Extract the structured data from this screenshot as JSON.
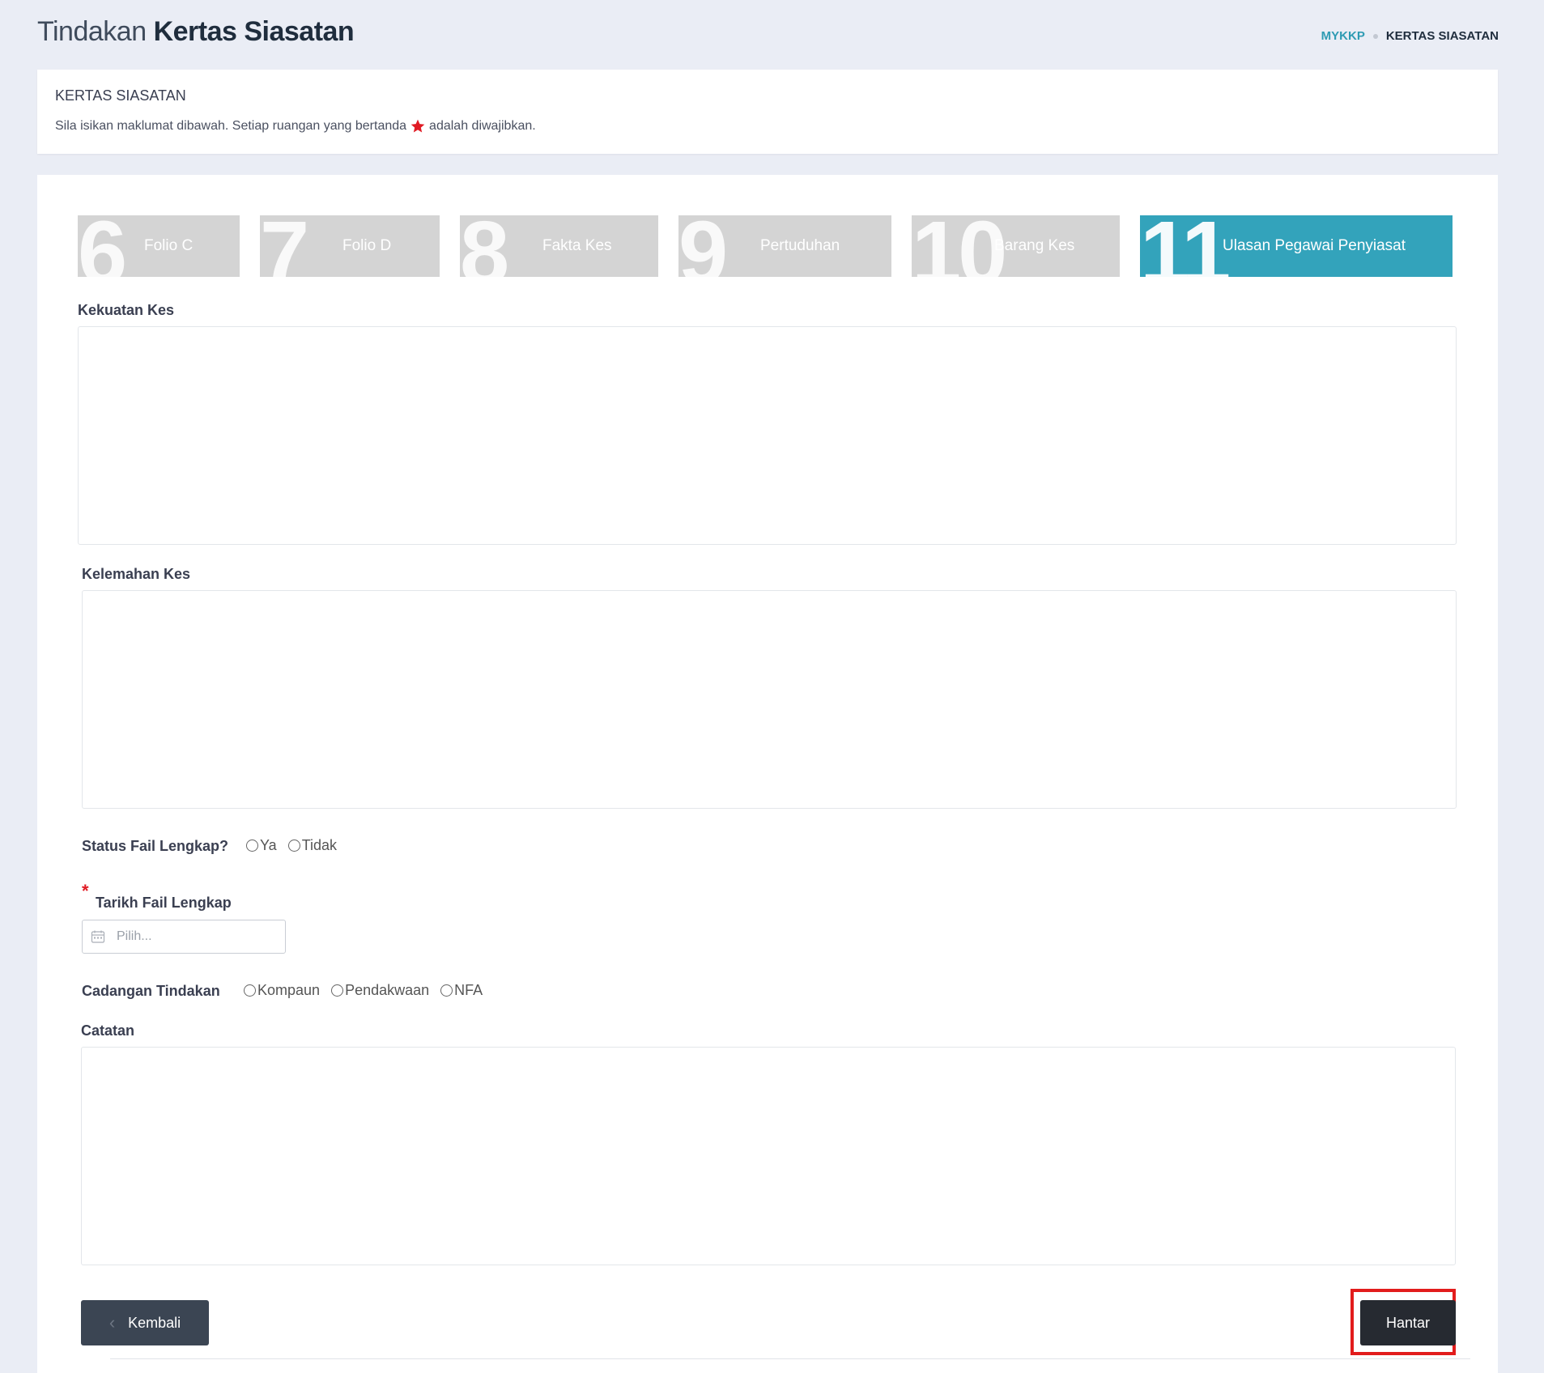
{
  "header": {
    "title_light": "Tindakan",
    "title_bold": "Kertas Siasatan",
    "breadcrumb": [
      "MYKKP",
      "KERTAS SIASATAN"
    ]
  },
  "info": {
    "title": "KERTAS SIASATAN",
    "desc_before": "Sila isikan maklumat dibawah. Setiap ruangan yang bertanda",
    "desc_after": "adalah diwajibkan."
  },
  "steps": [
    {
      "num": "6",
      "label": "Folio C"
    },
    {
      "num": "7",
      "label": "Folio D"
    },
    {
      "num": "8",
      "label": "Fakta Kes"
    },
    {
      "num": "9",
      "label": "Pertuduhan"
    },
    {
      "num": "10",
      "label": "Barang Kes"
    },
    {
      "num": "11",
      "label": "Ulasan Pegawai Penyiasat"
    }
  ],
  "form": {
    "kekuatan_label": "Kekuatan Kes",
    "kelemahan_label": "Kelemahan Kes",
    "status_label": "Status Fail Lengkap?",
    "status_options": [
      "Ya",
      "Tidak"
    ],
    "tarikh_label": "Tarikh Fail Lengkap",
    "tarikh_placeholder": "Pilih...",
    "cadangan_label": "Cadangan Tindakan",
    "cadangan_options": [
      "Kompaun",
      "Pendakwaan",
      "NFA"
    ],
    "catatan_label": "Catatan",
    "required_marker": "*"
  },
  "buttons": {
    "back": "Kembali",
    "submit": "Hantar"
  },
  "colors": {
    "accent": "#33a3bb",
    "step_inactive": "#d4d4d4",
    "required": "#e01b24",
    "highlight": "#e21c1c"
  }
}
